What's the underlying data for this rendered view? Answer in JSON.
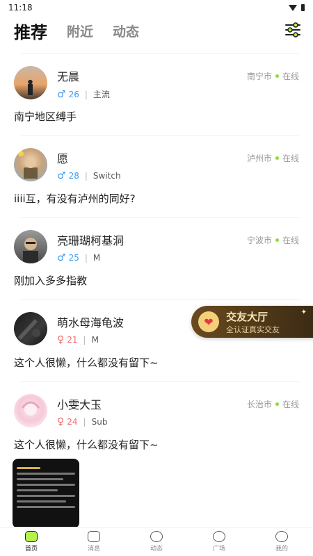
{
  "status": {
    "time": "11:18"
  },
  "nav": {
    "tabs": [
      {
        "label": "推荐"
      },
      {
        "label": "附近"
      },
      {
        "label": "动态"
      }
    ]
  },
  "users": [
    {
      "name": "无晨",
      "gender": "male",
      "age": "26",
      "tag": "主流",
      "city": "南宁市",
      "status": "在线",
      "bio": "南宁地区缚手"
    },
    {
      "name": "愿",
      "gender": "male",
      "age": "28",
      "tag": "Switch",
      "city": "泸州市",
      "status": "在线",
      "bio": "iiii互，有没有泸州的同好?"
    },
    {
      "name": "亮珊瑚柯基洞",
      "gender": "male",
      "age": "25",
      "tag": "M",
      "city": "宁波市",
      "status": "在线",
      "bio": "刚加入多多指教"
    },
    {
      "name": "萌水母海龟波",
      "gender": "female",
      "age": "21",
      "tag": "M",
      "city": "",
      "status": "",
      "bio": "这个人很懒，什么都没有留下~"
    },
    {
      "name": "小雯大玉",
      "gender": "female",
      "age": "24",
      "tag": "Sub",
      "city": "长治市",
      "status": "在线",
      "bio": "这个人很懒，什么都没有留下~"
    }
  ],
  "banner": {
    "title": "交友大厅",
    "subtitle": "全认证真实交友"
  },
  "tabbar": [
    {
      "label": "首页"
    },
    {
      "label": "消息"
    },
    {
      "label": "动态"
    },
    {
      "label": "广场"
    },
    {
      "label": "我的"
    }
  ],
  "icons": {
    "male": "♂",
    "female": "♀",
    "heart": "❤"
  },
  "colors": {
    "accent": "#b7f24a",
    "male": "#3a9bf0",
    "female": "#f46a6a",
    "online": "#8bdc3a"
  }
}
